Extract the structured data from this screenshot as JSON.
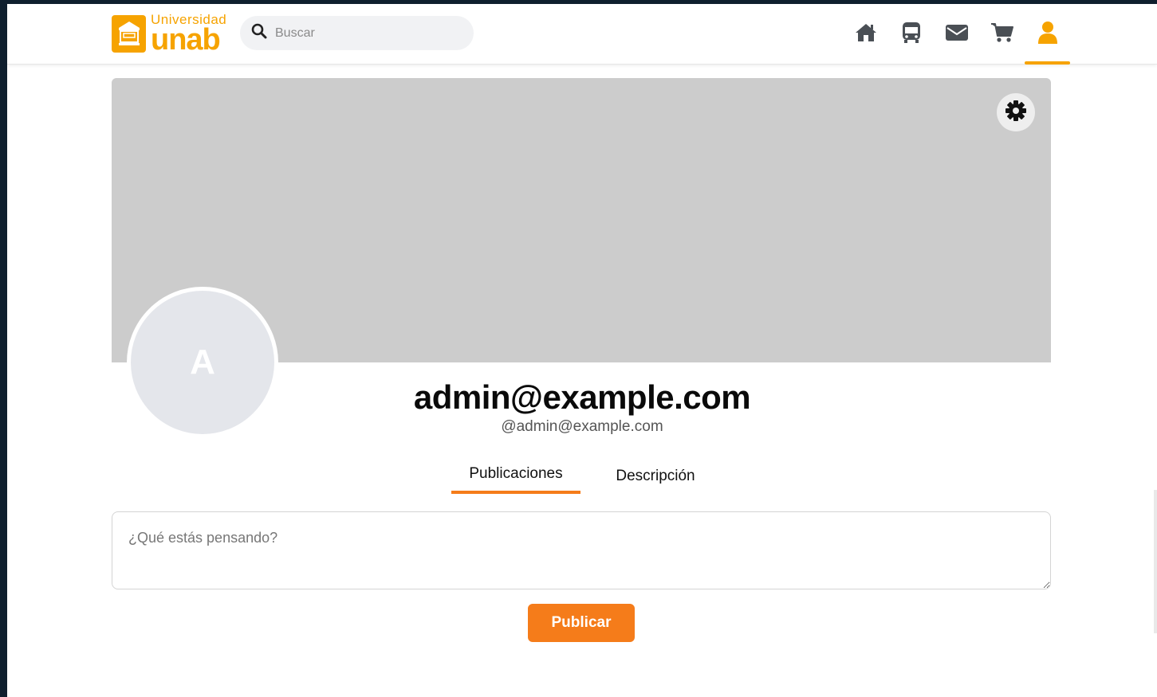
{
  "brand": {
    "small_text": "Universidad",
    "big_text": "unab",
    "accent_color": "#f6a300"
  },
  "search": {
    "placeholder": "Buscar",
    "value": ""
  },
  "nav": {
    "items": [
      {
        "name": "home-icon",
        "active": false
      },
      {
        "name": "bus-icon",
        "active": false
      },
      {
        "name": "mail-icon",
        "active": false
      },
      {
        "name": "cart-icon",
        "active": false
      },
      {
        "name": "user-icon",
        "active": true
      }
    ]
  },
  "profile": {
    "avatar_letter": "A",
    "name": "admin@example.com",
    "handle": "@admin@example.com"
  },
  "tabs": {
    "publications": "Publicaciones",
    "description": "Descripción",
    "active": "publications"
  },
  "composer": {
    "placeholder": "¿Qué estás pensando?",
    "value": "",
    "publish_label": "Publicar",
    "button_color": "#f57c1a"
  }
}
